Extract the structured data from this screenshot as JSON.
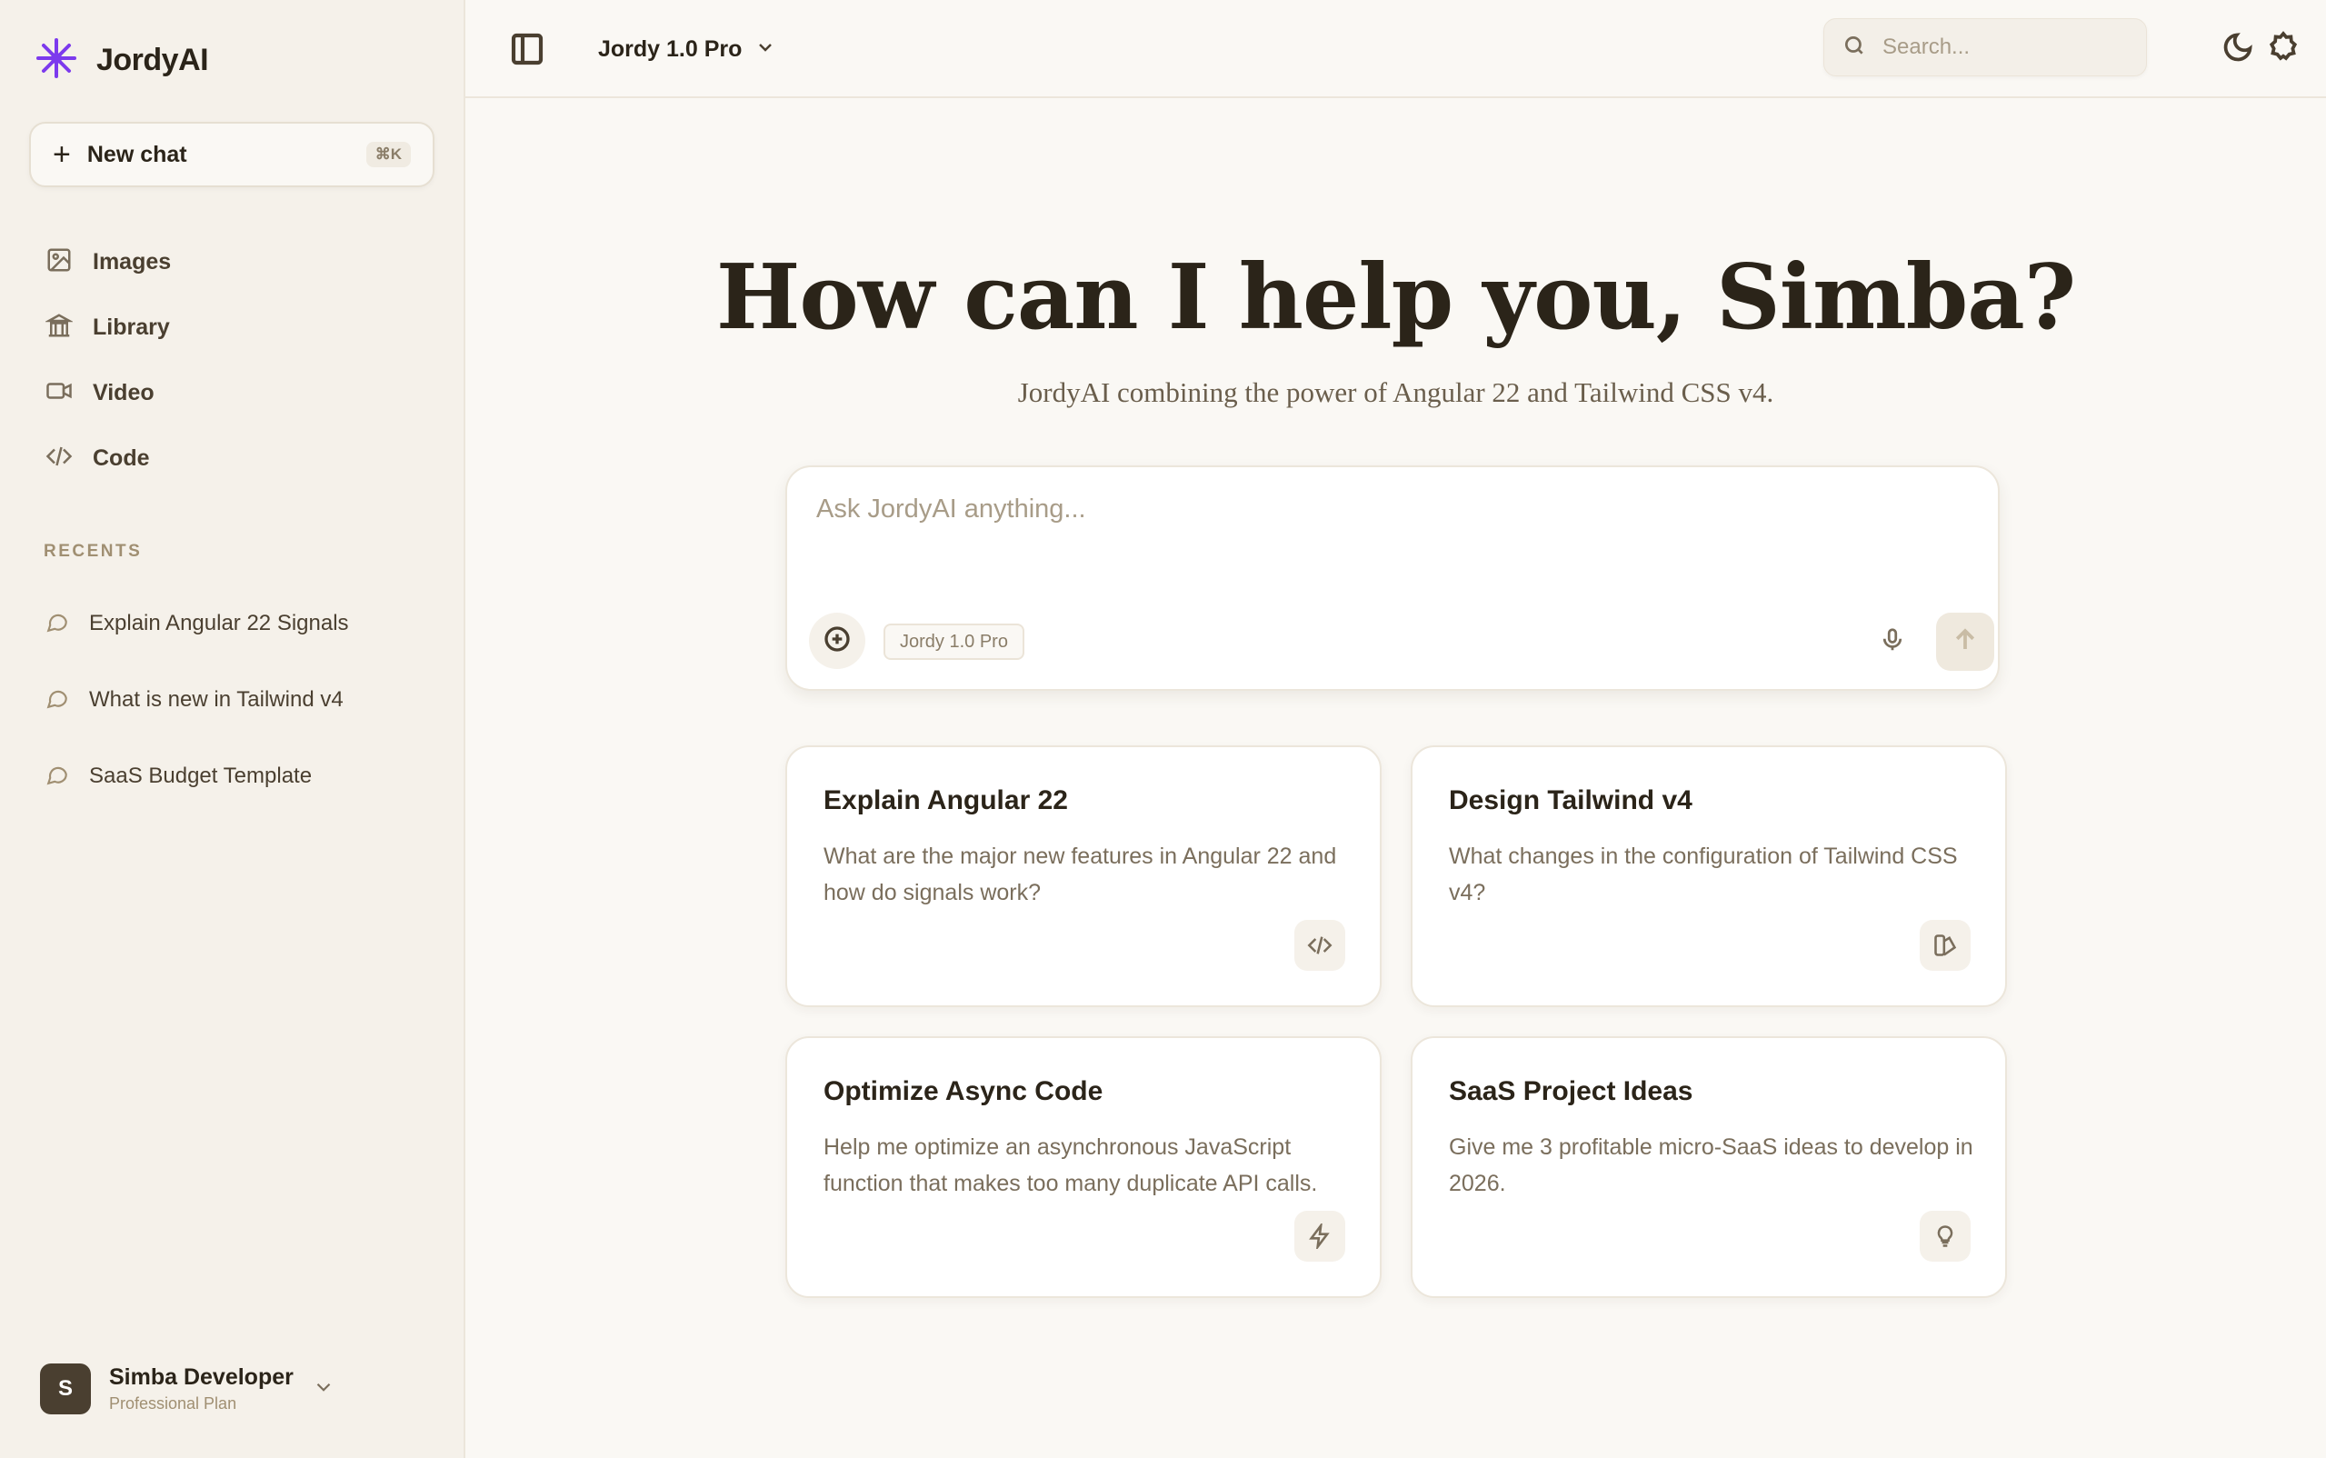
{
  "brand": {
    "name": "JordyAI",
    "accent": "#7c3aed"
  },
  "sidebar": {
    "new_chat": {
      "label": "New chat",
      "shortcut": "⌘K"
    },
    "nav": [
      {
        "label": "Images",
        "icon": "image-icon"
      },
      {
        "label": "Library",
        "icon": "library-icon"
      },
      {
        "label": "Video",
        "icon": "video-icon"
      },
      {
        "label": "Code",
        "icon": "code-icon"
      }
    ],
    "recents_title": "RECENTS",
    "recents": [
      {
        "label": "Explain Angular 22 Signals"
      },
      {
        "label": "What is new in Tailwind v4"
      },
      {
        "label": "SaaS Budget Template"
      }
    ],
    "user": {
      "initial": "S",
      "name": "Simba Developer",
      "plan": "Professional Plan"
    }
  },
  "topbar": {
    "model": "Jordy 1.0 Pro",
    "search_placeholder": "Search..."
  },
  "hero": {
    "title": "How can I help you, Simba?",
    "subtitle": "JordyAI combining the power of Angular 22 and Tailwind CSS v4."
  },
  "composer": {
    "placeholder": "Ask JordyAI anything...",
    "model_chip": "Jordy 1.0 Pro"
  },
  "cards": [
    {
      "title": "Explain Angular 22",
      "desc": "What are the major new features in Angular 22 and how do signals work?",
      "icon": "code-icon"
    },
    {
      "title": "Design Tailwind v4",
      "desc": "What changes in the configuration of Tailwind CSS v4?",
      "icon": "palette-icon"
    },
    {
      "title": "Optimize Async Code",
      "desc": "Help me optimize an asynchronous JavaScript function that makes too many duplicate API calls.",
      "icon": "lightning-icon"
    },
    {
      "title": "SaaS Project Ideas",
      "desc": "Give me 3 profitable micro-SaaS ideas to develop in 2026.",
      "icon": "lightbulb-icon"
    }
  ]
}
